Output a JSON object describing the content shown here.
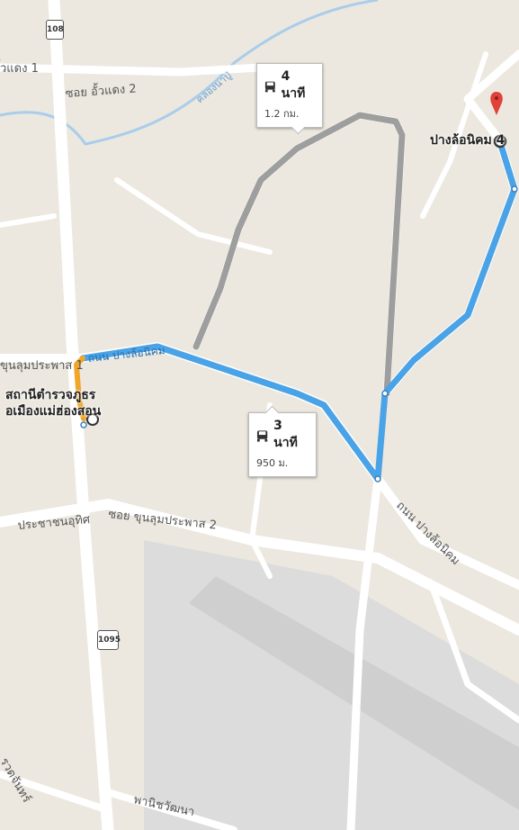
{
  "map": {
    "route_options": [
      {
        "id": "primary",
        "duration": "3 นาที",
        "distance": "950 ม.",
        "color": "#4aa3e6",
        "icon": "car-icon"
      },
      {
        "id": "alternate",
        "duration": "4 นาที",
        "distance": "1.2 กม.",
        "color": "#9e9e9e",
        "icon": "car-icon"
      }
    ],
    "origin": {
      "name_line1": "สถานีตำรวจภูธร",
      "name_line2": "อเมืองแม่ฮ่องสอน"
    },
    "destination": {
      "name": "ปางล้อนิคม 4"
    },
    "road_labels": {
      "soi_uasdang_1": "ิ้วแดง 1",
      "soi_uasdang_2": "ซอย อั้วแดง 2",
      "khlong": "คลองนาปู่",
      "soi_khunlum_1": "ขุนลุมประพาส 1",
      "thanon_panglonikhom_top": "ถนน ปางล้อนิคม",
      "thanon_panglonikhom_right": "ถนน ปางล้อนิคม",
      "pracharat": "ประชาชนอุทิศ",
      "soi_khunlum_2": "ซอย ขุนลุมประพาส 2",
      "phanitwattana": "พานิชวัฒนา",
      "bottom_left": "รวดจันทร์"
    },
    "highway_shields": {
      "top": "108",
      "bottom": "1095"
    },
    "colors": {
      "background": "#ece8df",
      "road": "#ffffff",
      "water": "#a9cdea",
      "runway": "#d6d6d6",
      "pin": "#e0413a",
      "origin_connector": "#f0a628"
    }
  }
}
